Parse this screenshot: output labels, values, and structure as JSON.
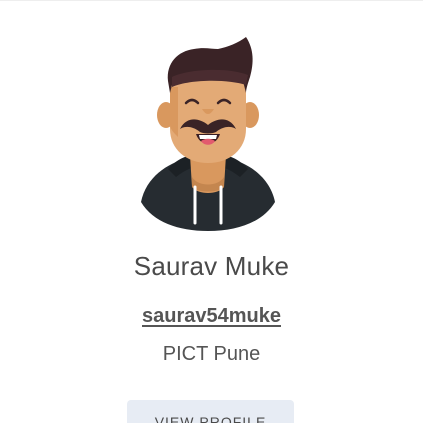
{
  "profile": {
    "name": "Saurav Muke",
    "username": "saurav54muke",
    "college": "PICT Pune",
    "avatar_icon": "cartoon-man-avatar-icon"
  },
  "actions": {
    "view_profile_label": "VIEW PROFILE"
  },
  "colors": {
    "skin": "#E3AA76",
    "hair": "#3A2326",
    "hoodie": "#262C31",
    "button_bg": "#E7ECF4"
  }
}
